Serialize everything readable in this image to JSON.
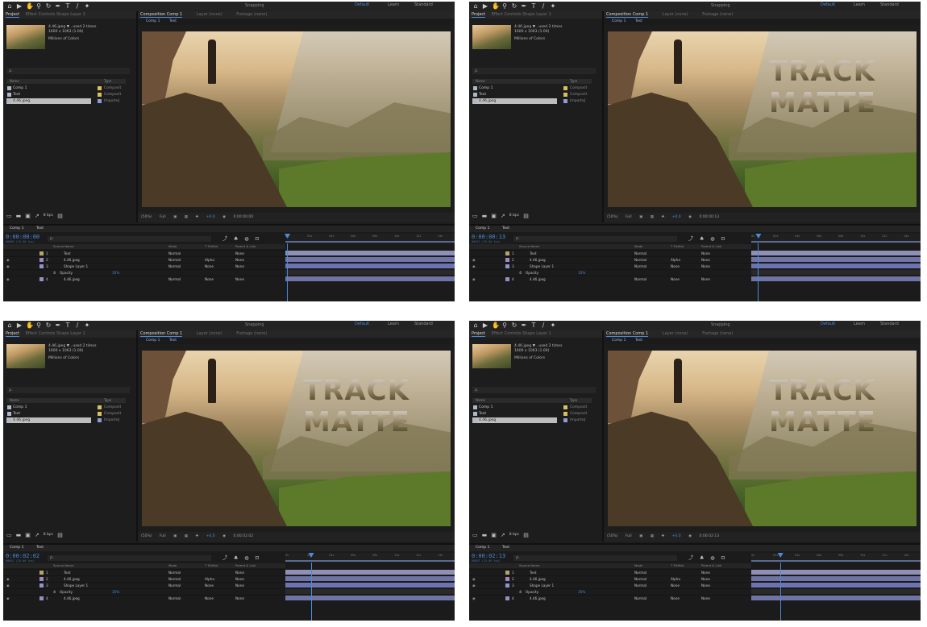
{
  "toolbar": {
    "workspaces": [
      "Default",
      "Learn",
      "Standard"
    ],
    "snapping_label": "Snapping"
  },
  "project_panel": {
    "tab_project": "Project",
    "tab_effect_controls": "Effect Controls Shape Layer 1",
    "footage_name": "4.46.jpeg ▼ , used 2 times",
    "footage_dims": "1600 x 1063 (1.00)",
    "footage_colors": "Millions of Colors",
    "search_placeholder": "ρ.",
    "columns": [
      "Name",
      "Type"
    ],
    "items": [
      {
        "name": "Comp 1",
        "type": "Composit"
      },
      {
        "name": "Text",
        "type": "Composit"
      },
      {
        "name": "4.46.jpeg",
        "type": "ImporteJ"
      }
    ],
    "bpc": "8 bpc"
  },
  "viewer": {
    "tab_composition": "Composition Comp 1",
    "tab_layer": "Layer (none)",
    "tab_footage": "Footage (none)",
    "breadcrumbs": [
      "Comp 1",
      "Text"
    ],
    "zoom": "(50%)",
    "resolution": "Full",
    "exposure": "+0.0"
  },
  "timeline": {
    "tabs": [
      "Comp 1",
      "Text"
    ],
    "search_placeholder": "ρ.",
    "ruler_labels": [
      "0s",
      "02s",
      "04s",
      "06s",
      "08s",
      "10s",
      "12s",
      "14s"
    ],
    "columns": [
      "Source Name",
      "Mode",
      "T TrkMat",
      "Parent & Link"
    ],
    "layers": [
      {
        "num": "1",
        "name": "Text",
        "mode": "Normal",
        "trkmat": "",
        "parent": "None"
      },
      {
        "num": "2",
        "name": "4.46.jpeg",
        "mode": "Normal",
        "trkmat": "Alpha",
        "parent": "None"
      },
      {
        "num": "3",
        "name": "Shape Layer 1",
        "mode": "Normal",
        "trkmat": "None",
        "parent": "None"
      }
    ],
    "opacity_label": "Opacity",
    "opacity_value": "35%",
    "bottom_layer": {
      "num": "4",
      "name": "4.46.jpeg",
      "mode": "Normal",
      "trkmat": "None",
      "parent": "None"
    }
  },
  "panels": [
    {
      "timecode": "0:00:00:00",
      "frames": "00000 (25.00 fps)",
      "overlay_line1": "",
      "overlay_line2": "",
      "playhead": 0.01
    },
    {
      "timecode": "0:00:00:13",
      "frames": "00013 (25.00 fps)",
      "overlay_line1": "TRACK",
      "overlay_line2": "MATTE",
      "playhead": 0.04
    },
    {
      "timecode": "0:00:02:02",
      "frames": "00052 (25.00 fps)",
      "overlay_line1": "TRACK",
      "overlay_line2": "MATTE",
      "playhead": 0.15
    },
    {
      "timecode": "0:00:02:13",
      "frames": "00063 (25.00 fps)",
      "overlay_line1": "TRACK",
      "overlay_line2": "MATTE",
      "playhead": 0.17
    }
  ]
}
